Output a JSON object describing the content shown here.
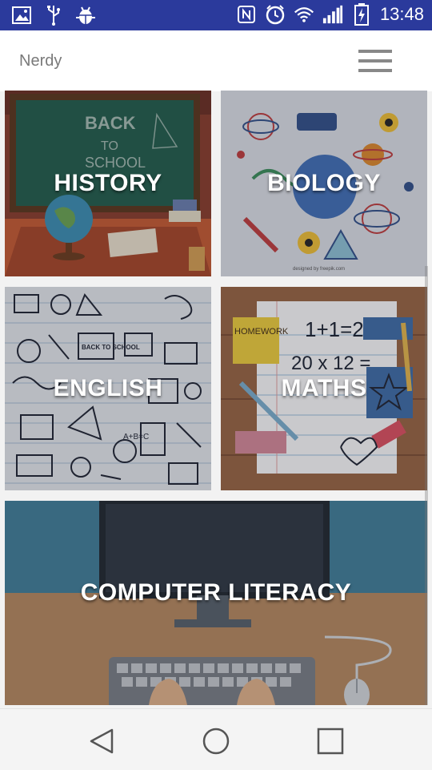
{
  "status_bar": {
    "time": "13:48",
    "left_icons": [
      "image-icon",
      "usb-icon",
      "android-debug-icon"
    ],
    "right_icons": [
      "nfc-icon",
      "alarm-icon",
      "wifi-icon",
      "signal-icon",
      "battery-charging-icon"
    ]
  },
  "app_bar": {
    "title": "Nerdy",
    "menu_icon": "hamburger-menu-icon"
  },
  "subjects": [
    {
      "label": "HISTORY",
      "theme": "classroom chalkboard with globe"
    },
    {
      "label": "BIOLOGY",
      "theme": "science molecules and lab doodles"
    },
    {
      "label": "ENGLISH",
      "theme": "school doodles on lined paper"
    },
    {
      "label": "MATHS",
      "theme": "notebook with 1+1=2 and 20 x 12 ="
    },
    {
      "label": "COMPUTER LITERACY",
      "theme": "desk with monitor, keyboard and mouse"
    }
  ],
  "maths_notes": {
    "line1": "1+1=2",
    "line2": "20 x 12 =",
    "sticky": "HOMEWORK"
  },
  "history_board": {
    "text": "BACK TO SCHOOL"
  },
  "nav_bar": {
    "buttons": [
      "back-icon",
      "home-icon",
      "recents-icon"
    ]
  },
  "colors": {
    "status_bar": "#2b3a9c",
    "app_bar": "#ffffff",
    "tile_overlay": "rgba(40,40,50,0.25)",
    "label": "#ffffff"
  }
}
